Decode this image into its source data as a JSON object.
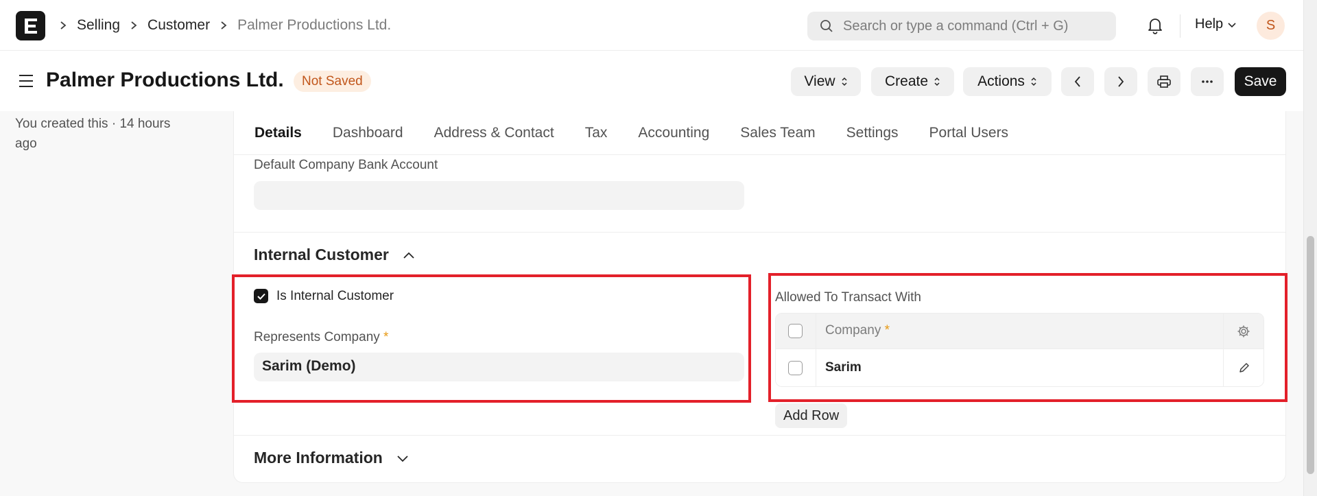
{
  "breadcrumb": [
    "Selling",
    "Customer",
    "Palmer Productions Ltd."
  ],
  "search": {
    "placeholder": "Search or type a command (Ctrl + G)"
  },
  "navbar": {
    "help_label": "Help",
    "avatar_initial": "S"
  },
  "header": {
    "title": "Palmer Productions Ltd.",
    "status": "Not Saved",
    "view_label": "View",
    "create_label": "Create",
    "actions_label": "Actions",
    "save_label": "Save"
  },
  "sidebar": {
    "created_text": "You created this · 14 hours ago"
  },
  "tabs": [
    "Details",
    "Dashboard",
    "Address & Contact",
    "Tax",
    "Accounting",
    "Sales Team",
    "Settings",
    "Portal Users"
  ],
  "form": {
    "bank_account_label": "Default Company Bank Account",
    "bank_account_value": "",
    "internal_section_title": "Internal Customer",
    "is_internal_label": "Is Internal Customer",
    "is_internal_checked": true,
    "represents_company_label": "Represents Company",
    "represents_company_value": "Sarim (Demo)",
    "allowed_label": "Allowed To Transact With",
    "grid_column": "Company",
    "grid_rows": [
      {
        "company": "Sarim"
      }
    ],
    "add_row_label": "Add Row",
    "more_info_title": "More Information"
  },
  "colors": {
    "accent_dark": "#171717",
    "status_orange": "#c1561b",
    "highlight_red": "#e3202a",
    "required_star": "#e79913"
  }
}
